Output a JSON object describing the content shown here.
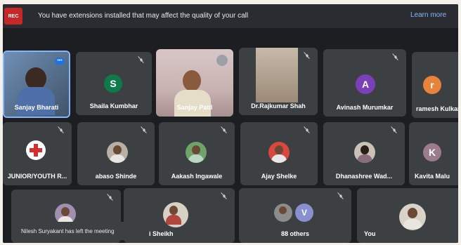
{
  "banner": {
    "rec": "REC",
    "text": "You have extensions installed that may affect the quality of your call",
    "learn_more": "Learn more"
  },
  "participants": [
    {
      "name": "Sanjay Bharati",
      "type": "video"
    },
    {
      "name": "Shaila Kumbhar",
      "type": "letter",
      "initial": "S",
      "color": "#0f7a4a"
    },
    {
      "name": "Sanjay Patil",
      "type": "video"
    },
    {
      "name": "Dr.Rajkumar Shah",
      "type": "video"
    },
    {
      "name": "Avinash Murumkar",
      "type": "letter",
      "initial": "A",
      "color": "#7b3fb8"
    },
    {
      "name": "ramesh Kulkarni",
      "type": "letter",
      "initial": "r",
      "color": "#e8833a"
    },
    {
      "name": "JUNIOR/YOUTH R...",
      "type": "logo"
    },
    {
      "name": "abaso Shinde",
      "type": "photo"
    },
    {
      "name": "Aakash Ingawale",
      "type": "photo"
    },
    {
      "name": "Ajay Shelke",
      "type": "photo"
    },
    {
      "name": "Dhanashree Wad...",
      "type": "photo"
    },
    {
      "name": "Kavita Malu",
      "type": "letter",
      "initial": "K",
      "color": "#9c7b8e"
    },
    {
      "name": "",
      "type": "photo"
    },
    {
      "name": "i Sheikh",
      "type": "photo"
    },
    {
      "name": "88 others",
      "type": "group",
      "initial": "V"
    },
    {
      "name": "You",
      "type": "photo"
    }
  ],
  "toast": "Nilesh Suryakant has left the meeting"
}
